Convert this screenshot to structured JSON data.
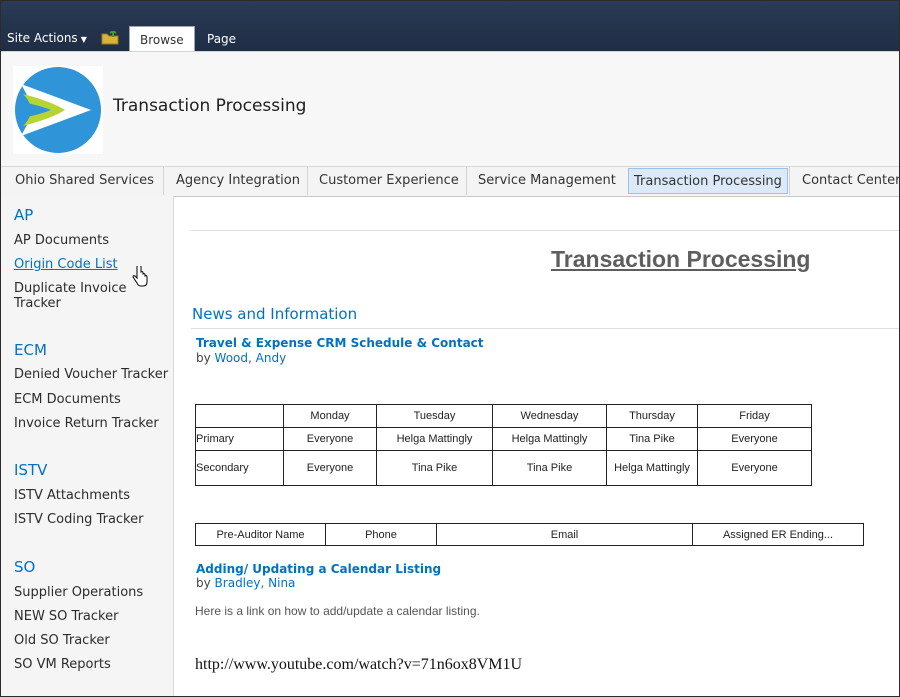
{
  "ribbon": {
    "site_actions": "Site Actions",
    "tabs": [
      {
        "label": "Browse"
      },
      {
        "label": "Page"
      }
    ]
  },
  "header": {
    "site_title": "Transaction Processing",
    "logo_icon": "site-logo-icon"
  },
  "topnav": {
    "items": [
      {
        "label": "Ohio Shared Services"
      },
      {
        "label": "Agency Integration"
      },
      {
        "label": "Customer Experience"
      },
      {
        "label": "Service Management"
      },
      {
        "label": "Transaction Processing"
      },
      {
        "label": "Contact Center"
      }
    ],
    "selected_index": 4
  },
  "leftnav": {
    "sections": [
      {
        "heading": "AP",
        "items": [
          "AP Documents",
          "Origin Code List",
          "Duplicate Invoice Tracker"
        ]
      },
      {
        "heading": "ECM",
        "items": [
          "Denied Voucher Tracker",
          "ECM Documents",
          "Invoice Return Tracker"
        ]
      },
      {
        "heading": "ISTV",
        "items": [
          "ISTV Attachments",
          "ISTV Coding Tracker"
        ]
      },
      {
        "heading": "SO",
        "items": [
          "Supplier Operations",
          "NEW SO Tracker",
          "Old SO Tracker",
          "SO VM Reports"
        ]
      }
    ],
    "hovered_item": "Origin Code List"
  },
  "main": {
    "page_heading": "Transaction Processing",
    "news_heading": "News and Information",
    "posts": [
      {
        "title": "Travel & Expense CRM Schedule & Contact",
        "by": "by",
        "author": "Wood, Andy"
      },
      {
        "title": "Adding/ Updating a Calendar Listing",
        "by": "by",
        "author": "Bradley, Nina"
      }
    ],
    "schedule": {
      "headers": [
        "",
        "Monday",
        "Tuesday",
        "Wednesday",
        "Thursday",
        "Friday"
      ],
      "rows": [
        [
          "Primary",
          "Everyone",
          "Helga Mattingly",
          "Helga Mattingly",
          "Tina Pike",
          "Everyone"
        ],
        [
          "Secondary",
          "Everyone",
          "Tina Pike",
          "Tina Pike",
          "Helga Mattingly",
          "Everyone"
        ]
      ]
    },
    "auditor_table": {
      "headers": [
        "Pre-Auditor Name",
        "Phone",
        "Email",
        "Assigned ER Ending..."
      ]
    },
    "note": "Here is a link on how to add/update a calendar listing.",
    "url": "http://www.youtube.com/watch?v=71n6ox8VM1U"
  },
  "colors": {
    "ribbon": "#1f2d45",
    "link": "#0072c6",
    "selected_nav_bg": "#dbe9f8"
  }
}
